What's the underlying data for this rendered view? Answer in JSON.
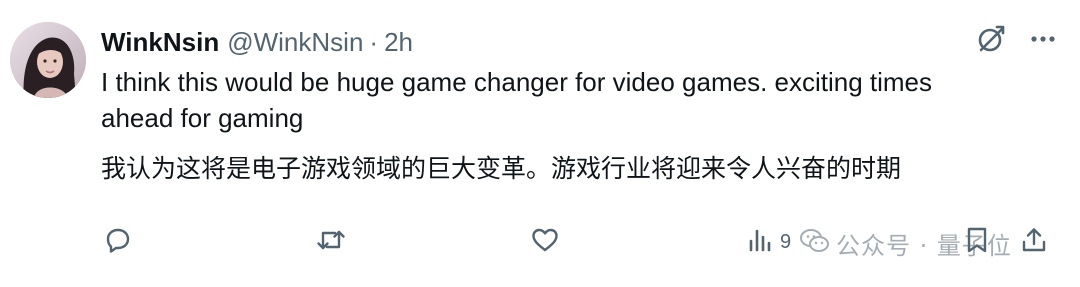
{
  "tweet": {
    "display_name": "WinkNsin",
    "handle": "@WinkNsin",
    "separator": "·",
    "time": "2h",
    "text_en": "I think this would be huge game changer for video games. exciting times\nahead for gaming",
    "text_zh": "我认为这将是电子游戏领域的巨大变革。游戏行业将迎来令人兴奋的时期"
  },
  "top_icons": [
    "grok-icon",
    "more-icon"
  ],
  "actions": {
    "reply": {
      "icon": "reply-icon",
      "count": ""
    },
    "retweet": {
      "icon": "retweet-icon",
      "count": ""
    },
    "like": {
      "icon": "like-icon",
      "count": ""
    },
    "views": {
      "icon": "views-icon",
      "count": "9"
    },
    "bookmark": {
      "icon": "bookmark-icon"
    },
    "share": {
      "icon": "share-icon"
    }
  },
  "watermark": {
    "icon": "wechat-icon",
    "text": "公众号 · 量子位"
  },
  "colors": {
    "text_primary": "#0f1419",
    "text_secondary": "#536471",
    "background": "#ffffff"
  }
}
